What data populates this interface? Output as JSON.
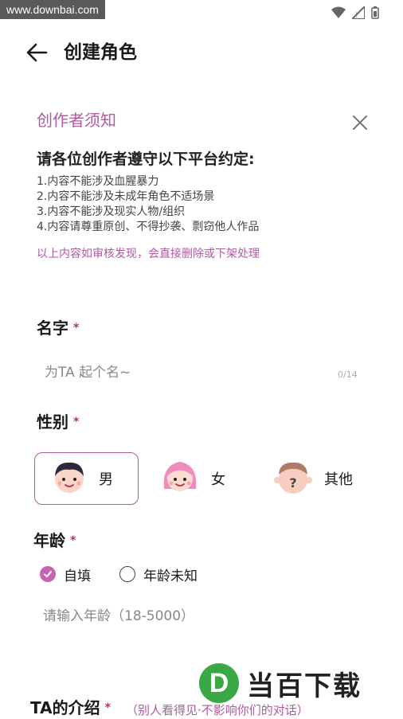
{
  "status_bar": {
    "watermark_url": "www.downbai.com",
    "icons": [
      "wifi-icon",
      "signal-icon",
      "battery-icon"
    ]
  },
  "header": {
    "title": "创建角色",
    "back_icon": "arrow-left-icon"
  },
  "notice": {
    "title": "创作者须知",
    "close_icon": "close-icon",
    "heading": "请各位创作者遵守以下平台约定:",
    "rules": [
      "1.内容不能涉及血腥暴力",
      "2.内容不能涉及未成年角色不适场景",
      "3.内容不能涉及现实人物/组织",
      "4.内容请尊重原创、不得抄袭、剽窃他人作品"
    ],
    "footer": "以上内容如审核发现，会直接删除或下架处理"
  },
  "form": {
    "required_mark": "*",
    "name": {
      "label": "名字",
      "placeholder": "为TA 起个名~",
      "counter": "0/14",
      "value": ""
    },
    "gender": {
      "label": "性别",
      "options": [
        {
          "label": "男",
          "icon": "male-avatar-icon",
          "selected": true
        },
        {
          "label": "女",
          "icon": "female-avatar-icon",
          "selected": false
        },
        {
          "label": "其他",
          "icon": "unknown-avatar-icon",
          "selected": false
        }
      ]
    },
    "age": {
      "label": "年龄",
      "options": [
        {
          "label": "自填",
          "selected": true
        },
        {
          "label": "年龄未知",
          "selected": false
        }
      ],
      "placeholder": "请输入年龄（18-5000）",
      "value": ""
    },
    "intro": {
      "label": "TA的介绍",
      "hint": "（别人看得见·不影响你们的对话）"
    }
  },
  "brand_watermark": {
    "badge_letter": "D",
    "text": "当百下载"
  },
  "colors": {
    "accent": "#b05aa0",
    "required": "#c0304a",
    "radio_on": "#c663b2",
    "brand_green": "#39a845"
  }
}
